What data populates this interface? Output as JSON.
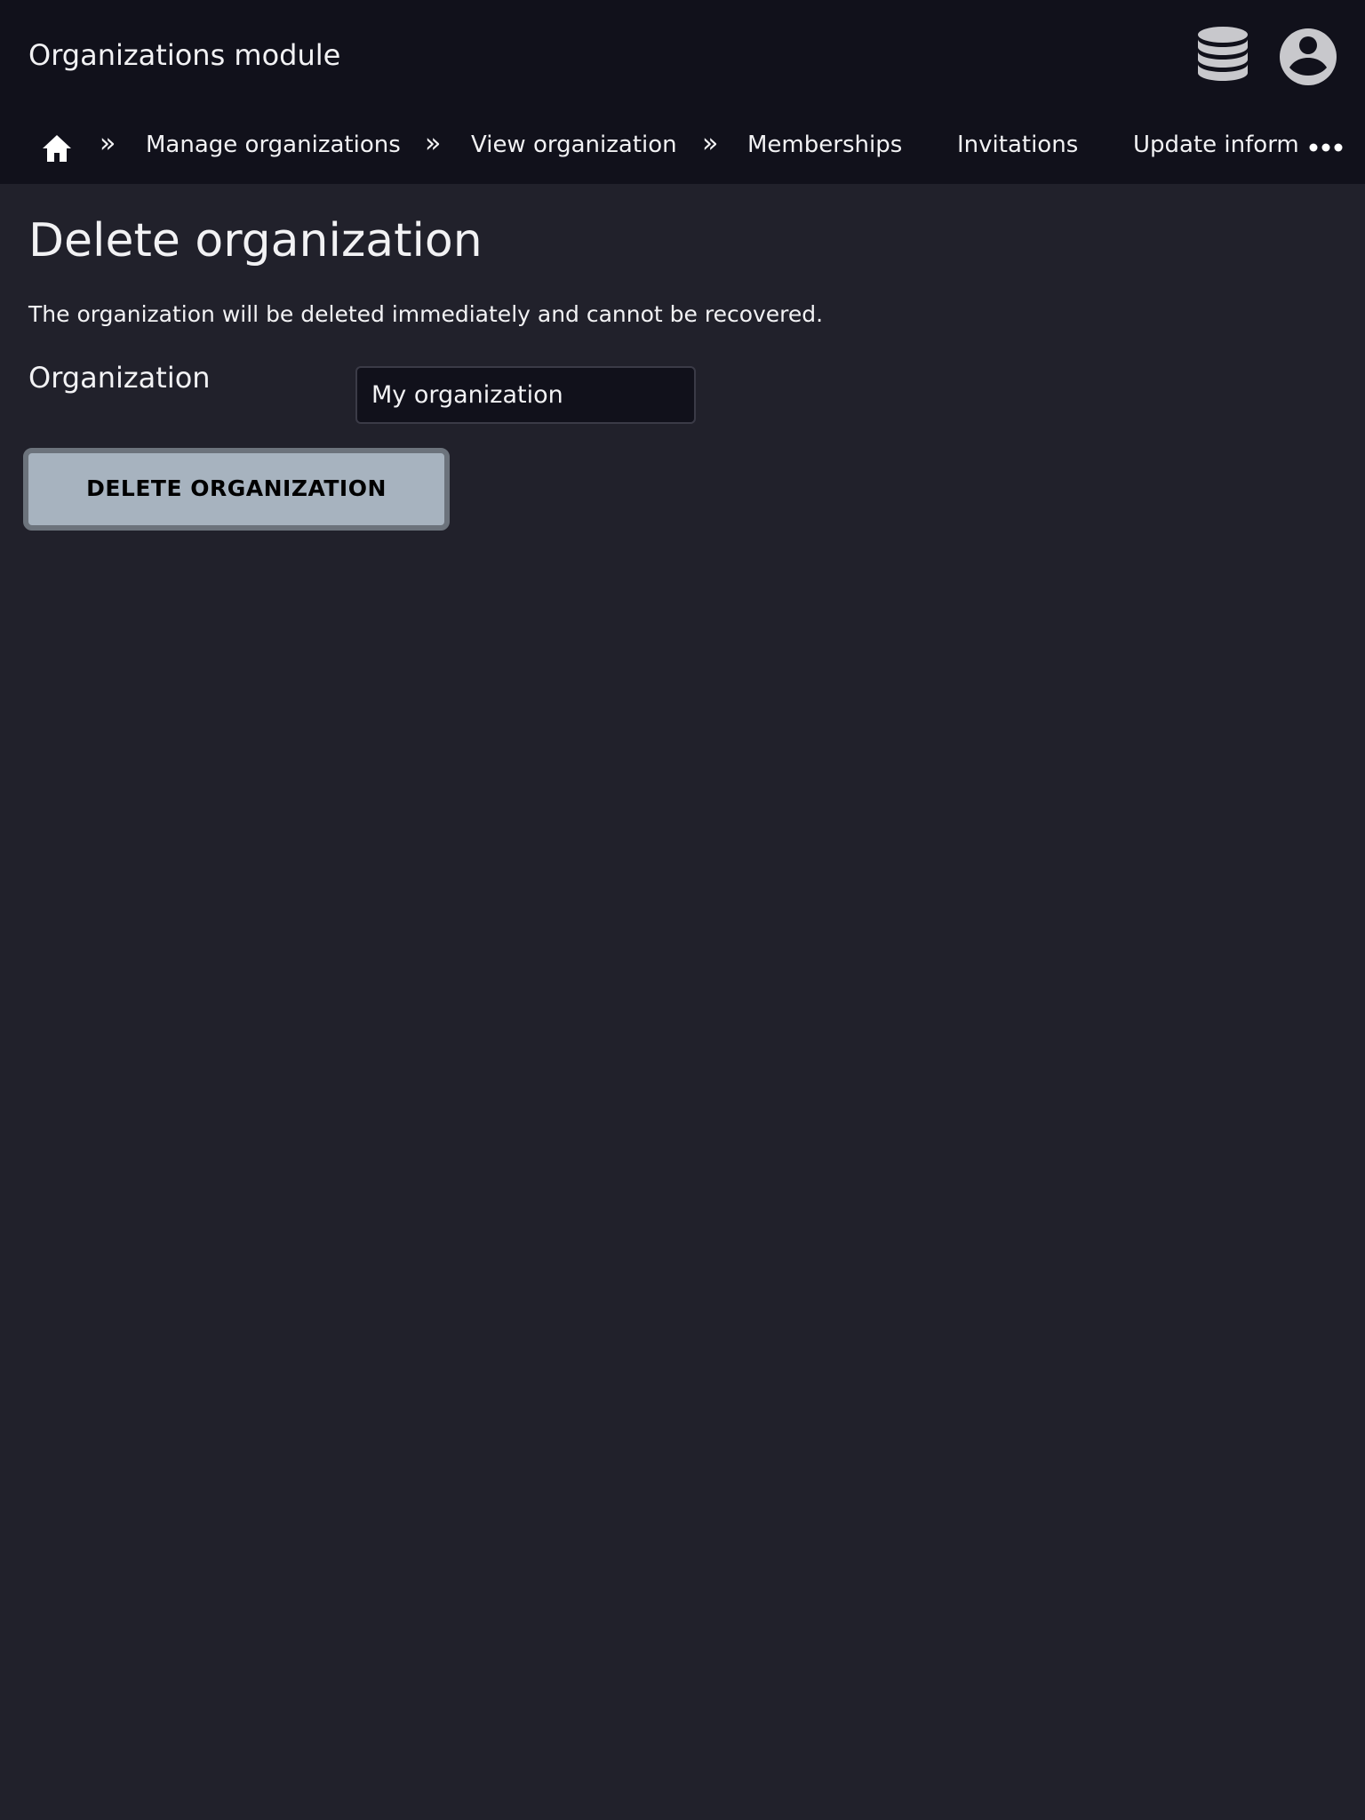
{
  "header": {
    "app_title": "Organizations module",
    "icons": {
      "database": "database-icon",
      "user": "user-account-icon"
    }
  },
  "breadcrumb": {
    "home_icon": "home-icon",
    "separator": "»",
    "items": [
      {
        "label": "Manage organizations"
      },
      {
        "label": "View organization"
      }
    ],
    "tabs": [
      {
        "label": "Memberships"
      },
      {
        "label": "Invitations"
      },
      {
        "label": "Update inform"
      }
    ],
    "overflow_icon": "more-horizontal-icon"
  },
  "main": {
    "title": "Delete organization",
    "warning": "The organization will be deleted immediately and cannot be recovered.",
    "organization_field": {
      "label": "Organization",
      "value": "My organization"
    },
    "delete_button_label": "DELETE ORGANIZATION"
  },
  "colors": {
    "topbar_bg": "#11111b",
    "page_bg": "#21212b",
    "button_bg": "#a7b3bf",
    "button_border": "#6c737c",
    "text": "#f2f2f4"
  }
}
